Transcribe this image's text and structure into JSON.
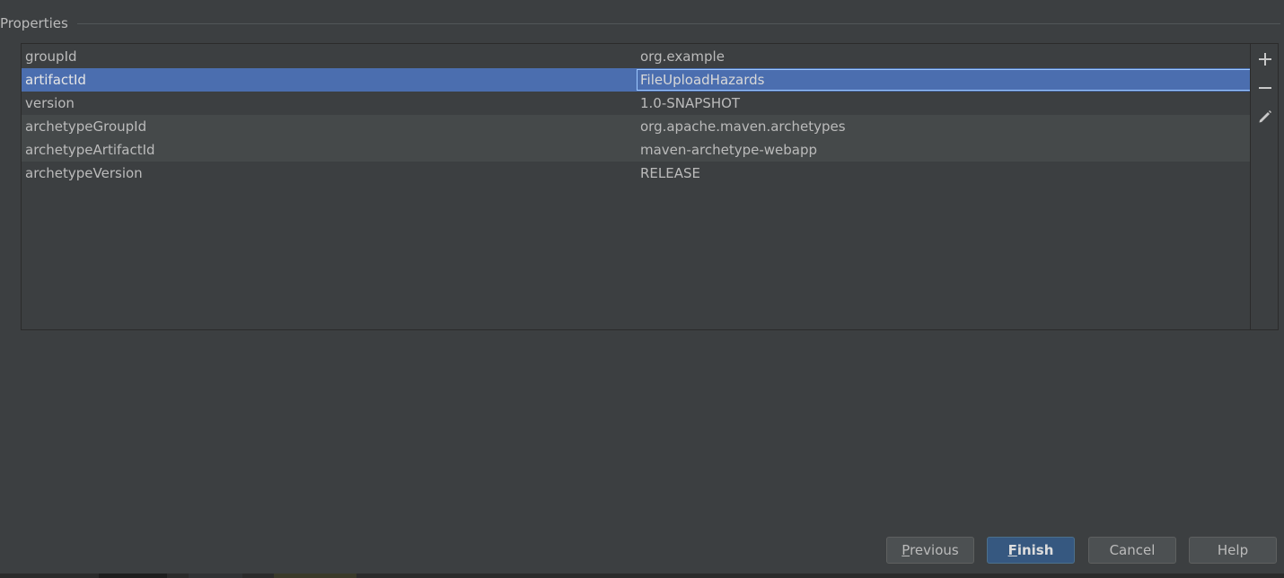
{
  "section": {
    "title": "Properties"
  },
  "properties": [
    {
      "key": "groupId",
      "value": "org.example"
    },
    {
      "key": "artifactId",
      "value": "FileUploadHazards"
    },
    {
      "key": "version",
      "value": "1.0-SNAPSHOT"
    },
    {
      "key": "archetypeGroupId",
      "value": "org.apache.maven.archetypes"
    },
    {
      "key": "archetypeArtifactId",
      "value": "maven-archetype-webapp"
    },
    {
      "key": "archetypeVersion",
      "value": "RELEASE"
    }
  ],
  "selected_row_index": 1,
  "toolbar": {
    "add_icon": "plus-icon",
    "remove_icon": "minus-icon",
    "edit_icon": "pencil-icon"
  },
  "buttons": {
    "previous": {
      "mnemonic": "P",
      "rest": "revious"
    },
    "finish": {
      "mnemonic": "F",
      "rest": "inish"
    },
    "cancel": "Cancel",
    "help": "Help"
  },
  "colors": {
    "background": "#3c3f41",
    "selection": "#4b6eaf",
    "alt_row": "#45494a",
    "default_button": "#365880",
    "edit_border": "#9cc7ff"
  }
}
